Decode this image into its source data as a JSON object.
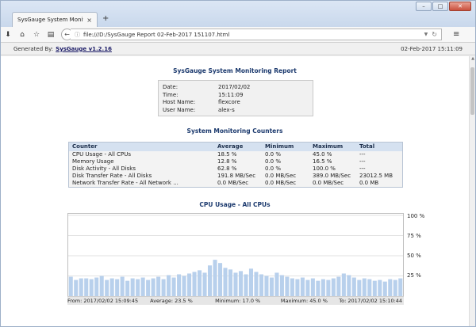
{
  "browser": {
    "tab_title": "SysGauge System Monitoring R...",
    "tab_close": "×",
    "new_tab": "+",
    "url": "file:///D:/SysGauge Report 02-Feb-2017 151107.html",
    "win_min": "–",
    "win_max": "□",
    "win_close": "✕"
  },
  "header": {
    "generated_by": "Generated By:",
    "product_link": "SysGauge v1.2.16",
    "date": "02-Feb-2017 15:11:09"
  },
  "report": {
    "title": "SysGauge System Monitoring Report",
    "info": [
      {
        "key": "Date:",
        "value": "2017/02/02"
      },
      {
        "key": "Time:",
        "value": "15:11:09"
      },
      {
        "key": "Host Name:",
        "value": "flexcore"
      },
      {
        "key": "User Name:",
        "value": "alex-s"
      }
    ]
  },
  "counters": {
    "title": "System Monitoring Counters",
    "headers": [
      "Counter",
      "Average",
      "Minimum",
      "Maximum",
      "Total"
    ],
    "rows": [
      [
        "CPU Usage - All CPUs",
        "18.5 %",
        "0.0 %",
        "45.0 %",
        "---"
      ],
      [
        "Memory Usage",
        "12.8 %",
        "0.0 %",
        "16.5 %",
        "---"
      ],
      [
        "Disk Activity - All Disks",
        "62.8 %",
        "0.0 %",
        "100.0 %",
        "---"
      ],
      [
        "Disk Transfer Rate - All Disks",
        "191.8 MB/Sec",
        "0.0 MB/Sec",
        "389.0 MB/Sec",
        "23012.5 MB"
      ],
      [
        "Network Transfer Rate - All Network ...",
        "0.0 MB/Sec",
        "0.0 MB/Sec",
        "0.0 MB/Sec",
        "0.0 MB"
      ]
    ]
  },
  "cpu_chart": {
    "title": "CPU Usage - All CPUs",
    "y_ticks": [
      "100 %",
      "75 %",
      "50 %",
      "25 %"
    ],
    "footer": {
      "from": "From: 2017/02/02 15:09:45",
      "average": "Average: 23.5 %",
      "minimum": "Minimum: 17.0 %",
      "maximum": "Maximum: 45.0 %",
      "to": "To: 2017/02/02 15:10:44"
    }
  },
  "chart_data": {
    "type": "bar",
    "title": "CPU Usage - All CPUs",
    "ylim": [
      0,
      100
    ],
    "y_ticks": [
      25,
      50,
      75,
      100
    ],
    "grid": true,
    "bar_color": "#b8d0ec",
    "values": [
      24,
      20,
      22,
      22,
      21,
      23,
      25,
      20,
      22,
      21,
      24,
      19,
      22,
      21,
      23,
      20,
      22,
      24,
      21,
      26,
      23,
      27,
      25,
      28,
      30,
      32,
      29,
      38,
      45,
      41,
      35,
      33,
      29,
      31,
      27,
      34,
      30,
      27,
      25,
      23,
      29,
      26,
      24,
      22,
      21,
      23,
      20,
      22,
      19,
      21,
      20,
      22,
      24,
      28,
      26,
      23,
      20,
      22,
      21,
      19,
      20,
      18,
      21,
      20,
      22
    ]
  }
}
